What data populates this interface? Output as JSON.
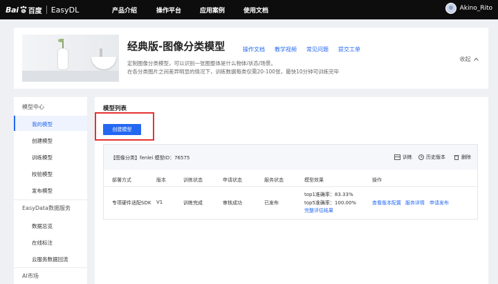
{
  "brand": {
    "logo_bai": "Bai",
    "logo_du": "百度",
    "product": "EasyDL"
  },
  "nav": {
    "items": [
      "产品介绍",
      "操作平台",
      "应用案例",
      "使用文档"
    ]
  },
  "user": {
    "name": "Akino_Rito"
  },
  "header": {
    "title": "经典版-图像分类模型",
    "links": [
      "操作文档",
      "教学视频",
      "常见问题",
      "提交工单"
    ],
    "desc1": "定制图像分类模型，可以识别一张图整体是什么物体/状态/场景。",
    "desc2": "在各分类图片之间差异明显的情况下，训练数据每类仅需20-100张，最快10分钟可训练完毕",
    "collapse": "收起"
  },
  "sidebar": {
    "group1": "模型中心",
    "items1": [
      "我的模型",
      "创建模型",
      "训练模型",
      "校验模型",
      "发布模型"
    ],
    "group2": "EasyData数据服务",
    "items2": [
      "数据总览",
      "在线标注",
      "云服务数据回流"
    ],
    "group3": "AI市场"
  },
  "main": {
    "title": "模型列表",
    "create_button": "创建模型",
    "card": {
      "title": "【图像分类】fenlei 模型ID：76575",
      "actions": [
        "训练",
        "历史版本",
        "删除"
      ],
      "columns": [
        "部署方式",
        "版本",
        "训练状态",
        "申请状态",
        "服务状态",
        "模型效果",
        "操作"
      ],
      "row": {
        "deploy": "专项硬件适配SDK",
        "version": "V1",
        "train_status": "训练完成",
        "apply_status": "审核成功",
        "service_status": "已发布",
        "effect_top1": "top1准确率：83.33%",
        "effect_top5": "top5准确率：100.00%",
        "effect_link": "完整评估结果",
        "ops": [
          "查看版本配置",
          "服务详情",
          "申请发布"
        ]
      }
    }
  },
  "colors": {
    "accent": "#2468f2",
    "highlight": "#e5312f",
    "topbar": "#0d0d0d"
  }
}
